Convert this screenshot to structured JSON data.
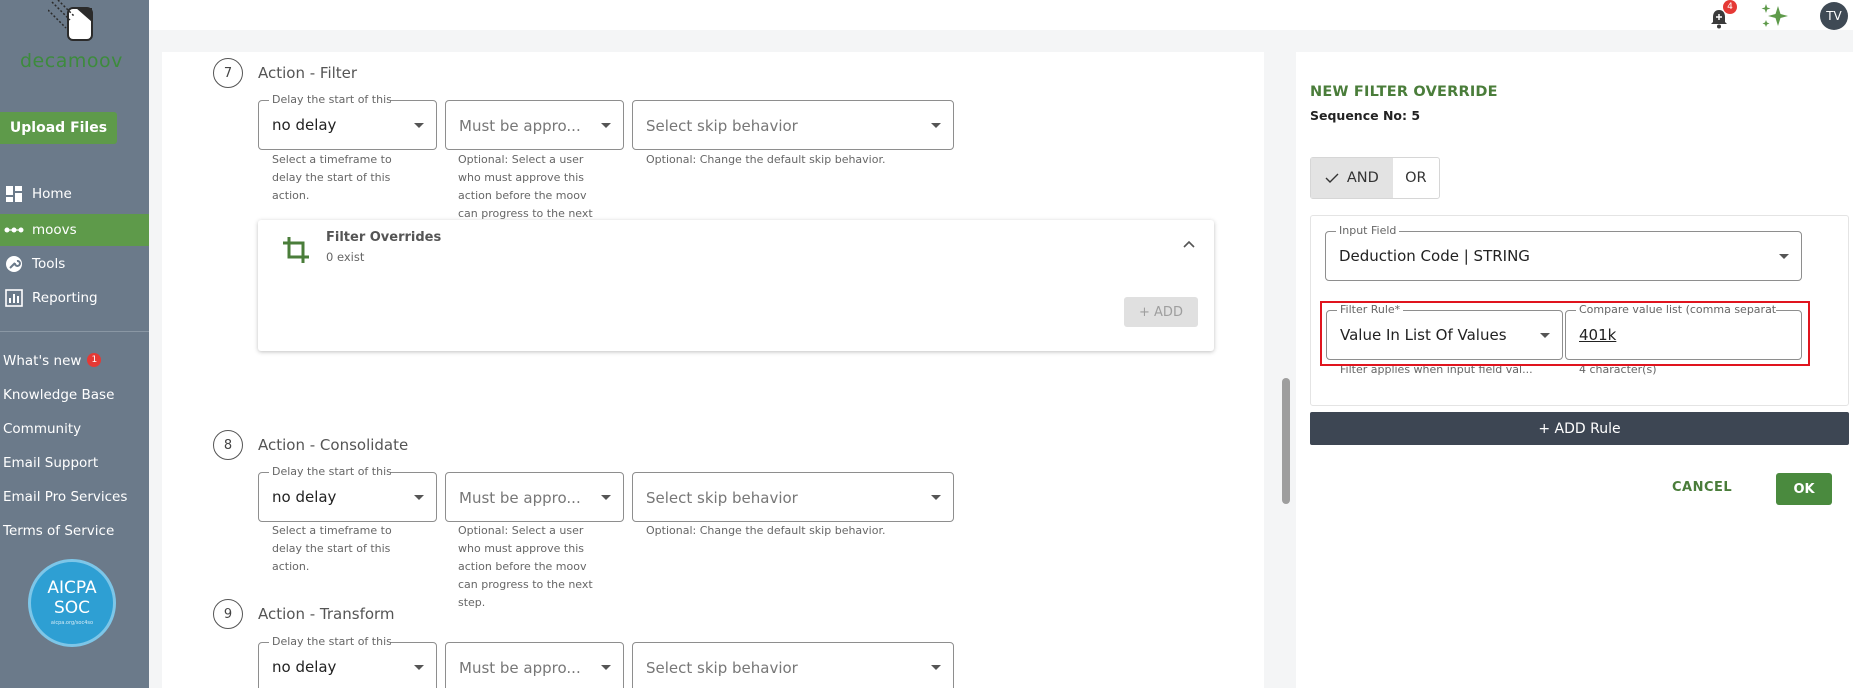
{
  "brand": {
    "logo_text": "decamoov"
  },
  "sidebar": {
    "upload_label": "Upload Files",
    "items": [
      {
        "label": "Home",
        "icon": "home-icon"
      },
      {
        "label": "moovs",
        "icon": "moovs-icon"
      },
      {
        "label": "Tools",
        "icon": "wrench-icon"
      },
      {
        "label": "Reporting",
        "icon": "chart-icon"
      }
    ],
    "links": [
      {
        "label": "What's new",
        "badge": "1"
      },
      {
        "label": "Knowledge Base"
      },
      {
        "label": "Community"
      },
      {
        "label": "Email Support"
      },
      {
        "label": "Email Pro Services"
      },
      {
        "label": "Terms of Service"
      }
    ],
    "cert": {
      "line1": "AICPA",
      "line2": "SOC",
      "line3": "aicpa.org/soc4so"
    }
  },
  "topbar": {
    "notification_count": "4",
    "avatar_initials": "TV"
  },
  "steps": [
    {
      "number": "7",
      "title": "Action - Filter",
      "delay_legend": "Delay the start of this",
      "delay_value": "no delay",
      "approve_placeholder": "Must be appro...",
      "skip_placeholder": "Select skip behavior",
      "delay_help": [
        "Select a timeframe to",
        "delay the start of this",
        "action."
      ],
      "approve_help": [
        "Optional: Select a user",
        "who must approve this",
        "action before the moov",
        "can progress to the next"
      ],
      "skip_help": "Optional: Change the default skip behavior."
    },
    {
      "number": "8",
      "title": "Action - Consolidate",
      "delay_legend": "Delay the start of this",
      "delay_value": "no delay",
      "approve_placeholder": "Must be appro...",
      "skip_placeholder": "Select skip behavior",
      "delay_help": [
        "Select a timeframe to",
        "delay the start of this",
        "action."
      ],
      "approve_help": [
        "Optional: Select a user",
        "who must approve this",
        "action before the moov",
        "can progress to the next",
        "step."
      ],
      "skip_help": "Optional: Change the default skip behavior."
    },
    {
      "number": "9",
      "title": "Action - Transform",
      "delay_legend": "Delay the start of this",
      "delay_value": "no delay",
      "approve_placeholder": "Must be appro...",
      "skip_placeholder": "Select skip behavior"
    }
  ],
  "overrides": {
    "title": "Filter Overrides",
    "count_text": "0 exist",
    "add_label": "+ ADD"
  },
  "panel": {
    "title": "NEW FILTER OVERRIDE",
    "sequence": "Sequence No: 5",
    "logic": {
      "and": "AND",
      "or": "OR",
      "selected": "AND"
    },
    "input_field": {
      "legend": "Input Field",
      "value": "Deduction Code | STRING"
    },
    "filter_rule": {
      "legend": "Filter Rule*",
      "value": "Value In List Of Values",
      "help": "Filter applies when input field val..."
    },
    "compare": {
      "legend": "Compare value list (comma separate",
      "value": "401k",
      "help": "4 character(s)"
    },
    "add_rule_label": "+ ADD Rule",
    "cancel_label": "CANCEL",
    "ok_label": "OK"
  },
  "colors": {
    "brand_green": "#5e9a4a",
    "sidebar_bg": "#6b7a8a",
    "highlight_red": "#e0141e",
    "dark_button": "#3d4653"
  }
}
